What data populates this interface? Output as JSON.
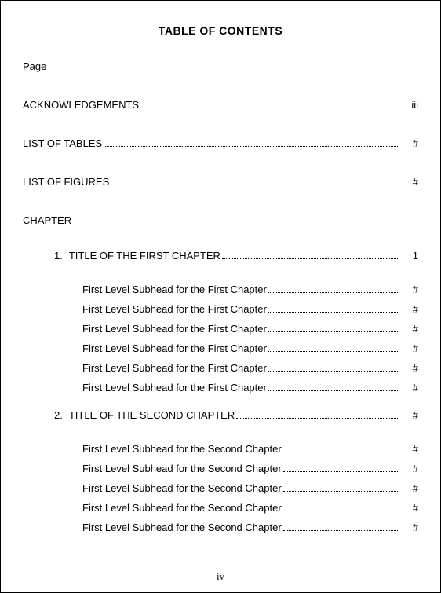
{
  "title": "TABLE OF CONTENTS",
  "page_label": "Page",
  "front_matter": [
    {
      "label": "ACKNOWLEDGEMENTS",
      "page": "iii"
    },
    {
      "label": "LIST OF TABLES",
      "page": "#"
    },
    {
      "label": "LIST OF FIGURES",
      "page": "#"
    }
  ],
  "chapter_heading": "CHAPTER",
  "chapters": [
    {
      "number": "1.",
      "title": "TITLE OF THE FIRST CHAPTER",
      "page": "1",
      "subheads": [
        {
          "label": "First Level Subhead for the First Chapter",
          "page": "#"
        },
        {
          "label": "First Level Subhead for the First Chapter",
          "page": "#"
        },
        {
          "label": "First Level Subhead for the First Chapter",
          "page": "#"
        },
        {
          "label": "First Level Subhead for the First Chapter",
          "page": "#"
        },
        {
          "label": "First Level Subhead for the First Chapter",
          "page": "#"
        },
        {
          "label": "First Level Subhead for the First Chapter",
          "page": "#"
        }
      ]
    },
    {
      "number": "2.",
      "title": "TITLE OF THE SECOND CHAPTER",
      "page": "#",
      "subheads": [
        {
          "label": "First Level Subhead for the Second Chapter",
          "page": "#"
        },
        {
          "label": "First Level Subhead for the Second Chapter",
          "page": "#"
        },
        {
          "label": "First Level Subhead for the Second Chapter",
          "page": "#"
        },
        {
          "label": "First Level Subhead for the Second Chapter",
          "page": "#"
        },
        {
          "label": "First Level Subhead for the Second Chapter",
          "page": "#"
        }
      ]
    }
  ],
  "footer_page_number": "iv"
}
